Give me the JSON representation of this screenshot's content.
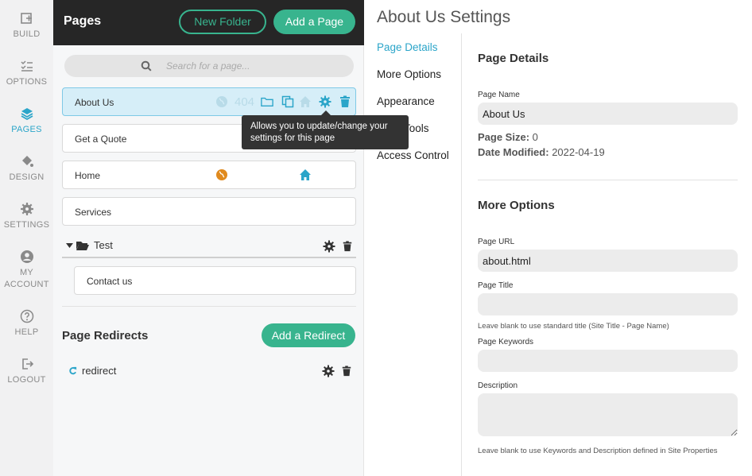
{
  "rail": [
    {
      "label": "BUILD",
      "icon": "build-icon"
    },
    {
      "label": "OPTIONS",
      "icon": "options-list-icon"
    },
    {
      "label": "PAGES",
      "icon": "layers-icon"
    },
    {
      "label": "DESIGN",
      "icon": "paint-bucket-icon"
    },
    {
      "label": "SETTINGS",
      "icon": "gear-icon"
    },
    {
      "label": "MY",
      "label2": "ACCOUNT",
      "icon": "user-icon"
    },
    {
      "label": "HELP",
      "icon": "help-icon"
    },
    {
      "label": "LOGOUT",
      "icon": "logout-icon"
    }
  ],
  "pages_panel": {
    "title": "Pages",
    "new_folder_label": "New Folder",
    "add_page_label": "Add a Page",
    "search_placeholder": "Search for a page...",
    "pages": [
      {
        "label": "About Us",
        "badge": "404"
      },
      {
        "label": "Get a Quote"
      },
      {
        "label": "Home"
      },
      {
        "label": "Services"
      }
    ],
    "folder": {
      "label": "Test",
      "children": [
        "Contact us"
      ]
    },
    "tooltip": "Allows you to update/change your settings for this page",
    "redirects_title": "Page Redirects",
    "add_redirect_label": "Add a Redirect",
    "redirects": [
      {
        "label": "redirect"
      }
    ]
  },
  "settings": {
    "title": "About Us Settings",
    "nav": [
      "Page Details",
      "More Options",
      "Appearance",
      "Tools",
      "Access Control"
    ],
    "page_details": {
      "section_title": "Page Details",
      "page_name_label": "Page Name",
      "page_name_value": "About Us",
      "page_size_label": "Page Size:",
      "page_size_value": "0",
      "date_modified_label": "Date Modified:",
      "date_modified_value": "2022-04-19"
    },
    "more_options": {
      "section_title": "More Options",
      "page_url_label": "Page URL",
      "page_url_value": "about.html",
      "page_title_label": "Page Title",
      "page_title_value": "",
      "page_title_hint": "Leave blank to use standard title (Site Title - Page Name)",
      "keywords_label": "Page Keywords",
      "keywords_value": "",
      "description_label": "Description",
      "description_value": "",
      "description_hint": "Leave blank to use Keywords and Description defined in Site Properties"
    }
  },
  "colors": {
    "accent": "#2ba5c9",
    "green": "#38b48e",
    "dark_header": "#262626",
    "orange_globe": "#e08a1e"
  }
}
